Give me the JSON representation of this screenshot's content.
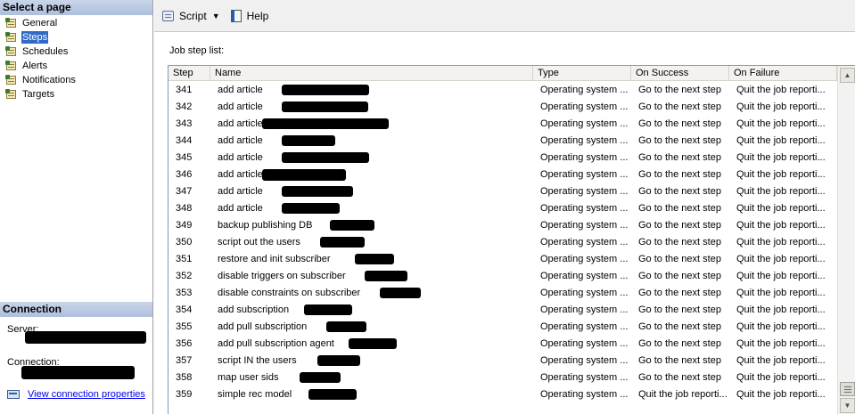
{
  "left_pane": {
    "select_page_header": "Select a page",
    "pages": [
      {
        "label": "General",
        "selected": false
      },
      {
        "label": "Steps",
        "selected": true
      },
      {
        "label": "Schedules",
        "selected": false
      },
      {
        "label": "Alerts",
        "selected": false
      },
      {
        "label": "Notifications",
        "selected": false
      },
      {
        "label": "Targets",
        "selected": false
      }
    ],
    "connection_header": "Connection",
    "server_label": "Server:",
    "connection_label": "Connection:",
    "view_connection_link": "View connection properties"
  },
  "toolbar": {
    "script_label": "Script",
    "help_label": "Help"
  },
  "main": {
    "list_title": "Job step list:",
    "columns": [
      "Step",
      "Name",
      "Type",
      "On Success",
      "On Failure"
    ],
    "rows": [
      {
        "step": "341",
        "name": "add article",
        "type": "Operating system ...",
        "on_success": "Go to the next step",
        "on_failure": "Quit the job reporti..."
      },
      {
        "step": "342",
        "name": "add article",
        "type": "Operating system ...",
        "on_success": "Go to the next step",
        "on_failure": "Quit the job reporti..."
      },
      {
        "step": "343",
        "name": "add article",
        "type": "Operating system ...",
        "on_success": "Go to the next step",
        "on_failure": "Quit the job reporti..."
      },
      {
        "step": "344",
        "name": "add article",
        "type": "Operating system ...",
        "on_success": "Go to the next step",
        "on_failure": "Quit the job reporti..."
      },
      {
        "step": "345",
        "name": "add article",
        "type": "Operating system ...",
        "on_success": "Go to the next step",
        "on_failure": "Quit the job reporti..."
      },
      {
        "step": "346",
        "name": "add article",
        "type": "Operating system ...",
        "on_success": "Go to the next step",
        "on_failure": "Quit the job reporti..."
      },
      {
        "step": "347",
        "name": "add article",
        "type": "Operating system ...",
        "on_success": "Go to the next step",
        "on_failure": "Quit the job reporti..."
      },
      {
        "step": "348",
        "name": "add article",
        "type": "Operating system ...",
        "on_success": "Go to the next step",
        "on_failure": "Quit the job reporti..."
      },
      {
        "step": "349",
        "name": "backup publishing DB",
        "type": "Operating system ...",
        "on_success": "Go to the next step",
        "on_failure": "Quit the job reporti..."
      },
      {
        "step": "350",
        "name": "script out the users",
        "type": "Operating system ...",
        "on_success": "Go to the next step",
        "on_failure": "Quit the job reporti..."
      },
      {
        "step": "351",
        "name": "restore and init subscriber",
        "type": "Operating system ...",
        "on_success": "Go to the next step",
        "on_failure": "Quit the job reporti..."
      },
      {
        "step": "352",
        "name": "disable triggers on subscriber",
        "type": "Operating system ...",
        "on_success": "Go to the next step",
        "on_failure": "Quit the job reporti..."
      },
      {
        "step": "353",
        "name": "disable constraints on subscriber",
        "type": "Operating system ...",
        "on_success": "Go to the next step",
        "on_failure": "Quit the job reporti..."
      },
      {
        "step": "354",
        "name": "add subscription",
        "type": "Operating system ...",
        "on_success": "Go to the next step",
        "on_failure": "Quit the job reporti..."
      },
      {
        "step": "355",
        "name": "add pull subscription",
        "type": "Operating system ...",
        "on_success": "Go to the next step",
        "on_failure": "Quit the job reporti..."
      },
      {
        "step": "356",
        "name": "add pull subscription agent",
        "type": "Operating system ...",
        "on_success": "Go to the next step",
        "on_failure": "Quit the job reporti..."
      },
      {
        "step": "357",
        "name": "script IN the users",
        "type": "Operating system ...",
        "on_success": "Go to the next step",
        "on_failure": "Quit the job reporti..."
      },
      {
        "step": "358",
        "name": "map user sids",
        "type": "Operating system ...",
        "on_success": "Go to the next step",
        "on_failure": "Quit the job reporti..."
      },
      {
        "step": "359",
        "name": "simple rec model",
        "type": "Operating system ...",
        "on_success": "Quit the job reporti...",
        "on_failure": "Quit the job reporti..."
      }
    ]
  },
  "colors": {
    "header_gradient_top": "#c9d6ea",
    "selected_highlight": "#3169c6",
    "link": "#0000ee",
    "redaction": "#000000"
  }
}
